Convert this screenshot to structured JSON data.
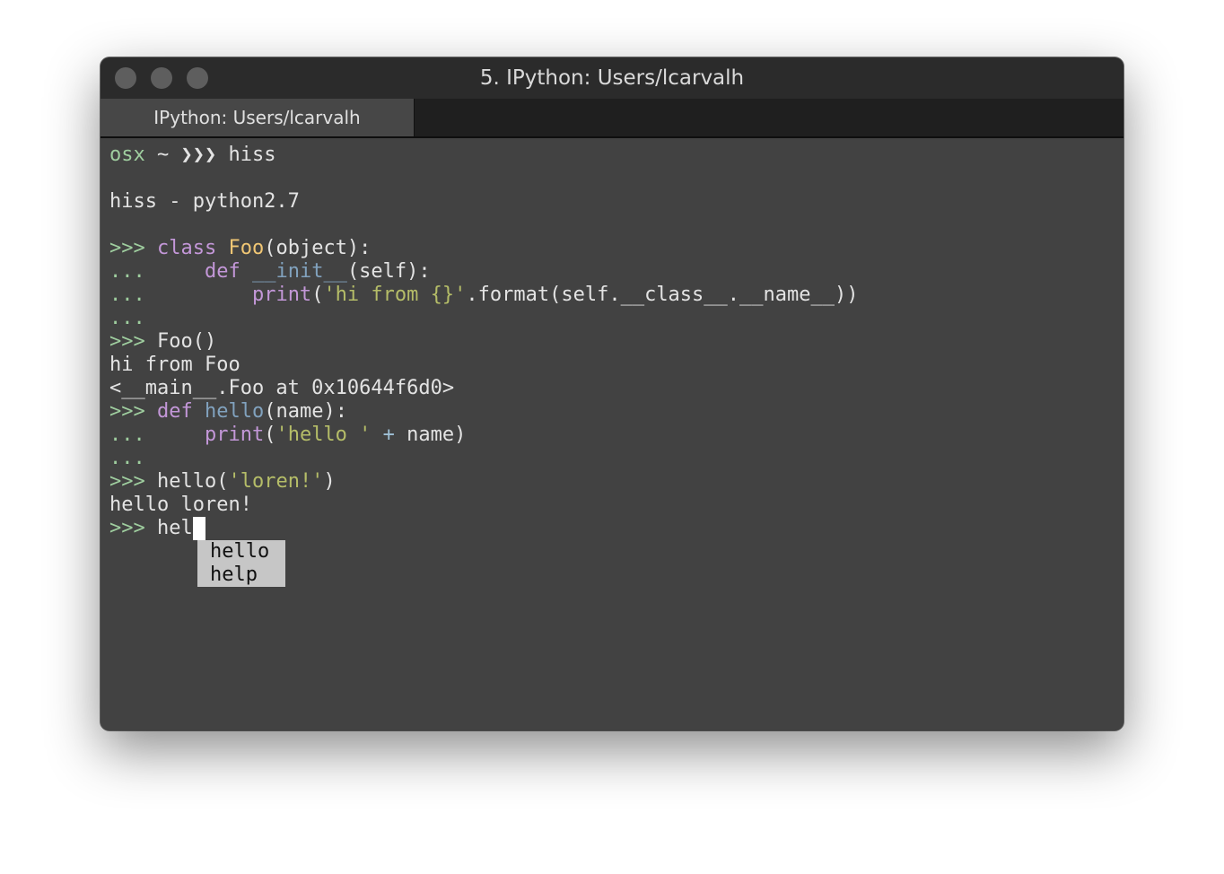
{
  "window": {
    "title": "5. IPython: Users/lcarvalh"
  },
  "tabs": [
    {
      "label": "IPython: Users/lcarvalh"
    }
  ],
  "terminal": {
    "shell": {
      "prompt_host": "osx",
      "prompt_dir": "~",
      "prompt_arrows": "❯❯❯",
      "command": "hiss"
    },
    "banner": "hiss - python2.7",
    "lines": {
      "l1": {
        "p": ">>> ",
        "kw": "class",
        "sp": " ",
        "name": "Foo",
        "rest": "(object):"
      },
      "l2": {
        "p": "...     ",
        "kw": "def",
        "sp": " ",
        "name": "__init__",
        "rest": "(self):"
      },
      "l3": {
        "p": "...         ",
        "fn": "print",
        "a": "(",
        "str": "'hi from {}'",
        "rest": ".format(self.__class__.__name__))"
      },
      "l4": {
        "p": "..."
      },
      "l5": {
        "p": ">>> ",
        "rest": "Foo()"
      },
      "l6": {
        "text": "hi from Foo"
      },
      "l7": {
        "text": "<__main__.Foo at 0x10644f6d0>"
      },
      "l8": {
        "p": ">>> ",
        "kw": "def",
        "sp": " ",
        "name": "hello",
        "rest": "(name):"
      },
      "l9": {
        "p": "...     ",
        "fn": "print",
        "a": "(",
        "str": "'hello '",
        "sp": " ",
        "op": "+",
        "rest": " name)"
      },
      "l10": {
        "p": "..."
      },
      "l11": {
        "p": ">>> ",
        "a": "hello(",
        "str": "'loren!'",
        "rest": ")"
      },
      "l12": {
        "text": "hello loren!"
      },
      "l13": {
        "p": ">>> ",
        "input": "hel"
      }
    },
    "completions": [
      "hello",
      "help"
    ]
  },
  "colors": {
    "prompt": "#9fce9f",
    "keyword": "#c397d8",
    "class_name": "#f0c674",
    "function_name": "#81a2be",
    "string": "#b5bd68",
    "background": "#424242",
    "completion_bg": "#c6c6c6"
  }
}
